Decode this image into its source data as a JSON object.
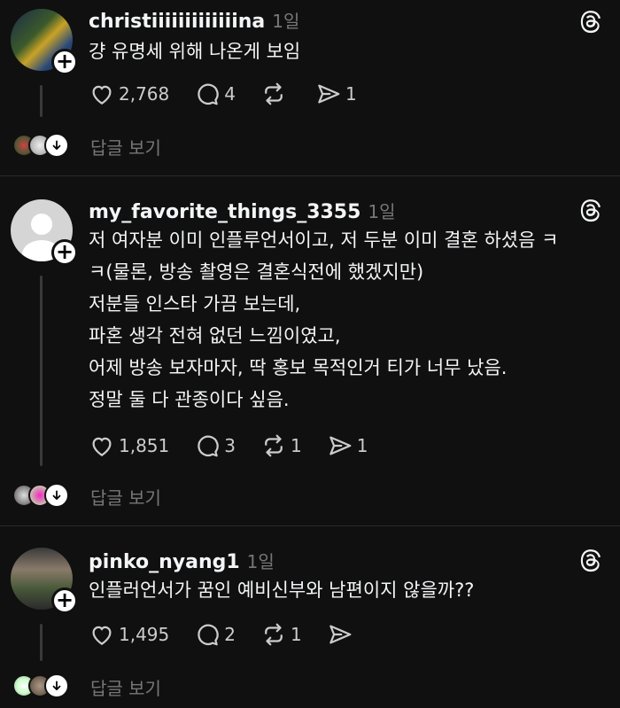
{
  "posts": [
    {
      "username": "christiiiiiiiiiiiiina",
      "time": "1일",
      "lines": [
        "걍 유명세 위해 나온게 보임"
      ],
      "likes": "2,768",
      "comments": "4",
      "reposts": "",
      "shares": "1",
      "view_replies": "답글 보기"
    },
    {
      "username": "my_favorite_things_3355",
      "time": "1일",
      "lines": [
        "저 여자분 이미 인플루언서이고, 저 두분 이미 결혼 하셨음 ㅋ",
        "ㅋ(물론, 방송 촬영은 결혼식전에 했겠지만)",
        "저분들 인스타 가끔 보는데,",
        "파혼 생각 전혀 없던 느낌이였고,",
        "어제 방송 보자마자, 딱 홍보 목적인거 티가 너무 났음.",
        "정말 둘 다 관종이다 싶음."
      ],
      "likes": "1,851",
      "comments": "3",
      "reposts": "1",
      "shares": "1",
      "view_replies": "답글 보기"
    },
    {
      "username": "pinko_nyang1",
      "time": "1일",
      "lines": [
        "인플러언서가 꿈인 예비신부와 남편이지 않을까??"
      ],
      "likes": "1,495",
      "comments": "2",
      "reposts": "1",
      "shares": "",
      "view_replies": "답글 보기"
    }
  ],
  "icons": {
    "like": "heart-icon",
    "comment": "comment-icon",
    "repost": "repost-icon",
    "share": "share-icon",
    "brand": "threads-logo-icon",
    "follow": "plus-icon",
    "expand": "chevron-down-icon"
  },
  "colors": {
    "background": "#101010",
    "text": "#f3f5f7",
    "muted": "#777777",
    "divider": "#2a2a2a"
  }
}
